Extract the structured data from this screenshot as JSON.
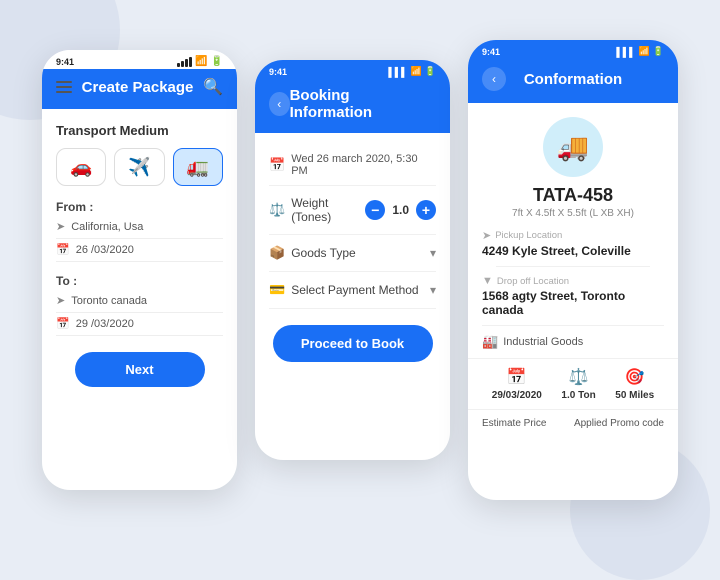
{
  "phone1": {
    "status_time": "9:41",
    "header_title": "Create Package",
    "transport_label": "Transport Medium",
    "transport_options": [
      "car",
      "plane",
      "truck"
    ],
    "from_label": "From :",
    "from_location": "California, Usa",
    "from_date": "26 /03/2020",
    "to_label": "To :",
    "to_location": "Toronto canada",
    "to_date": "29 /03/2020",
    "next_btn": "Next"
  },
  "phone2": {
    "status_time": "9:41",
    "header_title": "Booking Information",
    "date_value": "Wed 26 march 2020,  5:30 PM",
    "weight_label": "Weight (Tones)",
    "weight_value": "1.0",
    "goods_label": "Goods Type",
    "payment_label": "Select Payment Method",
    "proceed_btn": "Proceed to Book"
  },
  "phone3": {
    "status_time": "9:41",
    "header_title": "Conformation",
    "vehicle_name": "TATA-458",
    "vehicle_dims": "7ft X 4.5ft X 5.5ft (L XB XH)",
    "pickup_label": "Pickup Location",
    "pickup_value": "4249 Kyle Street, Coleville",
    "dropoff_label": "Drop off Location",
    "dropoff_value": "1568 agty Street, Toronto canada",
    "goods_type": "Industrial Goods",
    "stat1_icon": "calendar",
    "stat1_value": "29/03/2020",
    "stat2_icon": "weight",
    "stat2_value": "1.0 Ton",
    "stat3_icon": "distance",
    "stat3_value": "50 Miles",
    "bottom_left": "Estimate Price",
    "bottom_right": "Applied Promo code"
  }
}
